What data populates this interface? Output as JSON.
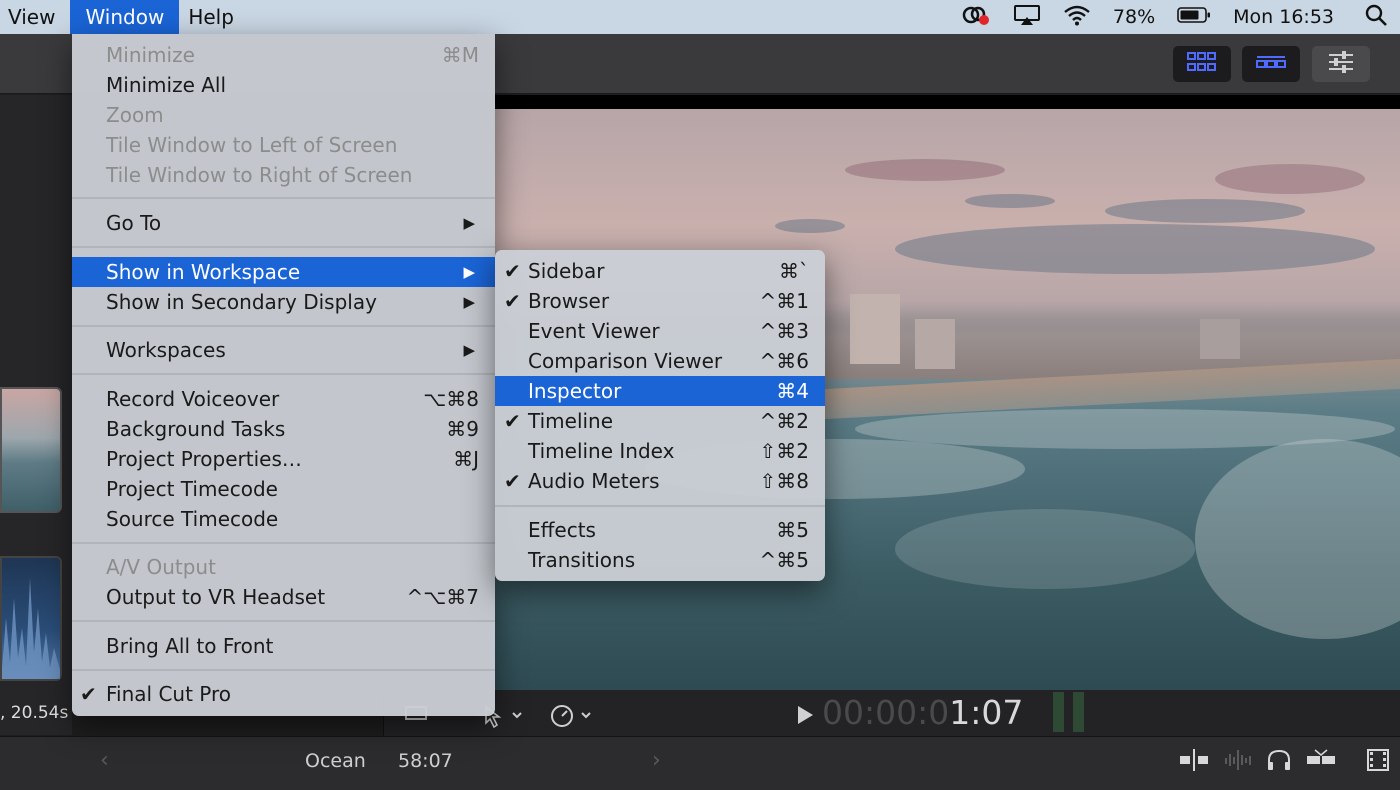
{
  "menubar": {
    "items": [
      "View",
      "Window",
      "Help"
    ],
    "battery_percent": "78%",
    "clock": "Mon 16:53"
  },
  "window_menu": {
    "items": [
      {
        "label": "Minimize",
        "shortcut": "⌘M"
      },
      {
        "label": "Minimize All",
        "shortcut": ""
      },
      {
        "label": "Zoom",
        "shortcut": ""
      },
      {
        "label": "Tile Window to Left of Screen",
        "shortcut": ""
      },
      {
        "label": "Tile Window to Right of Screen",
        "shortcut": ""
      },
      {
        "label": "Go To",
        "shortcut": ""
      },
      {
        "label": "Show in Workspace",
        "shortcut": ""
      },
      {
        "label": "Show in Secondary Display",
        "shortcut": ""
      },
      {
        "label": "Workspaces",
        "shortcut": ""
      },
      {
        "label": "Record Voiceover",
        "shortcut": "⌥⌘8"
      },
      {
        "label": "Background Tasks",
        "shortcut": "⌘9"
      },
      {
        "label": "Project Properties…",
        "shortcut": "⌘J"
      },
      {
        "label": "Project Timecode",
        "shortcut": ""
      },
      {
        "label": "Source Timecode",
        "shortcut": ""
      },
      {
        "label": "A/V Output",
        "shortcut": ""
      },
      {
        "label": "Output to VR Headset",
        "shortcut": "^⌥⌘7"
      },
      {
        "label": "Bring All to Front",
        "shortcut": ""
      },
      {
        "label": "Final Cut Pro",
        "shortcut": ""
      }
    ]
  },
  "workspace_submenu": {
    "items": [
      {
        "label": "Sidebar",
        "shortcut": "⌘`",
        "checked": true
      },
      {
        "label": "Browser",
        "shortcut": "^⌘1",
        "checked": true
      },
      {
        "label": "Event Viewer",
        "shortcut": "^⌘3",
        "checked": false
      },
      {
        "label": "Comparison Viewer",
        "shortcut": "^⌘6",
        "checked": false
      },
      {
        "label": "Inspector",
        "shortcut": "⌘4",
        "checked": false
      },
      {
        "label": "Timeline",
        "shortcut": "^⌘2",
        "checked": true
      },
      {
        "label": "Timeline Index",
        "shortcut": "⇧⌘2",
        "checked": false
      },
      {
        "label": "Audio Meters",
        "shortcut": "⇧⌘8",
        "checked": true
      },
      {
        "label": "Effects",
        "shortcut": "⌘5",
        "checked": false
      },
      {
        "label": "Transitions",
        "shortcut": "^⌘5",
        "checked": false
      }
    ]
  },
  "browser": {
    "clip_duration": ", 20.54s"
  },
  "viewer": {
    "timecode_dim": "00:00:0",
    "timecode_lit": "1:07"
  },
  "timeline": {
    "project_name": "Ocean",
    "project_duration": "58:07"
  },
  "colors": {
    "highlight": "#1a64d6",
    "menubar": "#c9d6e3"
  }
}
